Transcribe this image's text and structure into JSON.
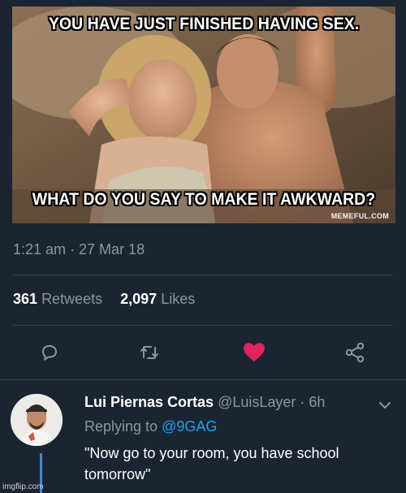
{
  "meme": {
    "top_caption": "YOU HAVE JUST FINISHED HAVING SEX.",
    "bottom_caption": "WHAT DO YOU SAY TO MAKE IT AWKWARD?",
    "watermark": "MEMEFUL.COM"
  },
  "tweet": {
    "timestamp": "1:21 am · 27 Mar 18",
    "retweets_count": "361",
    "retweets_label": "Retweets",
    "likes_count": "2,097",
    "likes_label": "Likes"
  },
  "actions": {
    "icons": [
      "reply-icon",
      "retweet-icon",
      "like-icon",
      "share-icon"
    ],
    "like_color": "#e0245e",
    "icon_color": "#8899a6"
  },
  "reply": {
    "name": "Lui Piernas Cortas",
    "handle": "@LuisLayer · 6h",
    "replying_prefix": "Replying to",
    "replying_to": "@9GAG",
    "text": "\"Now go to your room, you have school tomorrow\""
  },
  "footer": {
    "imgflip": "imgflip.com"
  },
  "colors": {
    "background": "#1b2431",
    "muted": "#8899a6",
    "link": "#1da1f2",
    "divider": "#38444d"
  }
}
